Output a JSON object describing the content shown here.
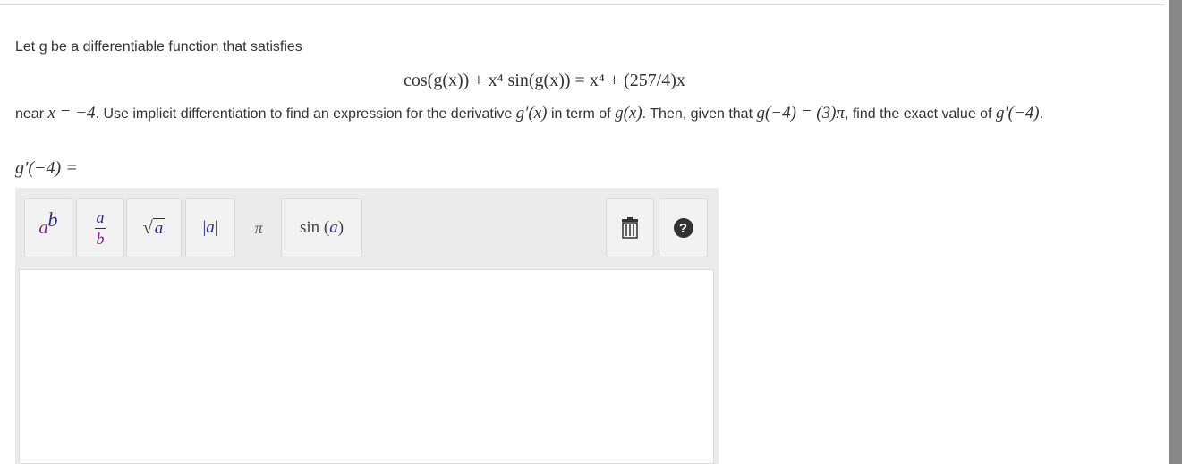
{
  "problem": {
    "intro": "Let g be a differentiable function that satisfies",
    "equation": "cos(g(x)) + x⁴ sin(g(x)) = x⁴ + (257/4)x",
    "near_text": "near",
    "near_value": "x = −4",
    "instructions": ". Use implicit differentiation to find an expression for the derivative",
    "derivative_symbol": "g′(x)",
    "in_term_of": "in term of",
    "g_of_x": "g(x)",
    "then_given": ". Then, given that",
    "given_condition": "g(−4) = (3)π",
    "find_exact": ", find the exact value of",
    "target": "g′(−4)",
    "period": "."
  },
  "answer": {
    "label": "g′(−4) ="
  },
  "toolbar": {
    "power": {
      "base": "a",
      "exp": "b"
    },
    "fraction": {
      "num": "a",
      "den": "b"
    },
    "sqrt": {
      "symbol": "√",
      "arg": "a"
    },
    "abs": {
      "left": "|",
      "arg": "a",
      "right": "|"
    },
    "pi": "π",
    "sin": {
      "func": "sin",
      "open": " (",
      "arg": "a",
      "close": ")"
    },
    "help": "?"
  },
  "icons": {
    "trash": "trash-icon",
    "help": "help-icon"
  }
}
